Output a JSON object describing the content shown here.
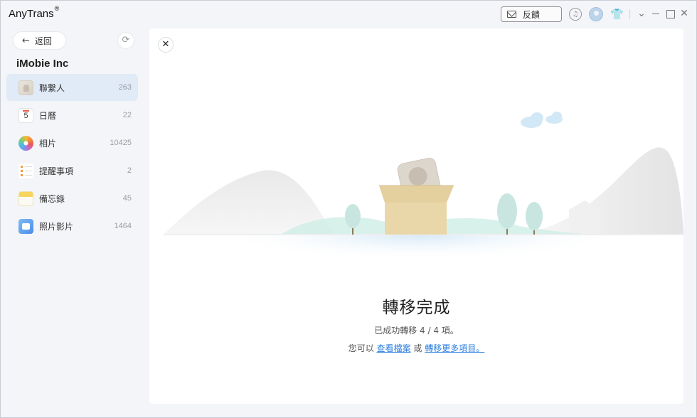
{
  "titlebar": {
    "app_name": "AnyTrans",
    "registered_mark": "®",
    "feedback_label": "反饋",
    "icons": [
      "mail-icon",
      "bell-icon",
      "avatar",
      "skin-icon",
      "chevron-down-icon",
      "minimize-icon",
      "maximize-icon",
      "close-icon"
    ]
  },
  "sidebar": {
    "back_label": "返回",
    "device_name": "iMobie Inc",
    "items": [
      {
        "label": "聯繫人",
        "count": "263",
        "icon": "contacts-icon",
        "active": true
      },
      {
        "label": "日曆",
        "count": "22",
        "icon": "calendar-icon",
        "calendar_day": "5"
      },
      {
        "label": "相片",
        "count": "10425",
        "icon": "photos-icon"
      },
      {
        "label": "提醒事項",
        "count": "2",
        "icon": "reminders-icon"
      },
      {
        "label": "備忘錄",
        "count": "45",
        "icon": "notes-icon"
      },
      {
        "label": "照片影片",
        "count": "1464",
        "icon": "video-icon"
      }
    ]
  },
  "main": {
    "title": "轉移完成",
    "message": "已成功轉移 4 / 4 項。",
    "links_prefix": "您可以",
    "view_files_link": "查看檔案",
    "or_text": "或",
    "transfer_more_link": "轉移更多項目。"
  },
  "colors": {
    "accent": "#2a7ee0",
    "active_item_bg": "#e1ebf7",
    "box": "#ead7a9",
    "tree": "#cfe7e0",
    "cloud": "#d7ebf7"
  }
}
